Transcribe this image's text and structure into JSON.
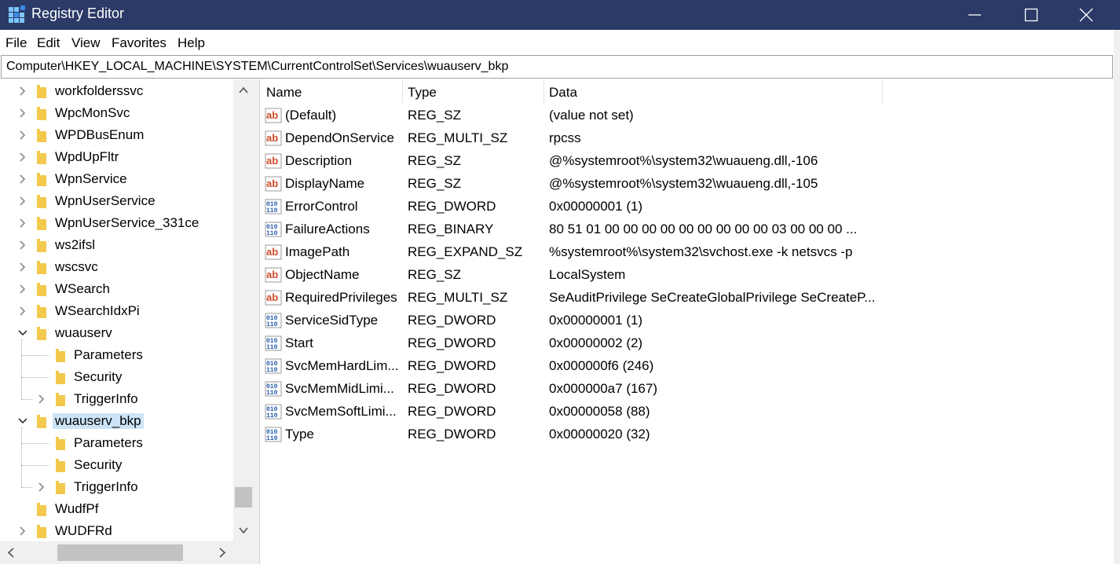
{
  "window": {
    "title": "Registry Editor",
    "title_bar_color": "#2b3a67"
  },
  "menu": [
    "File",
    "Edit",
    "View",
    "Favorites",
    "Help"
  ],
  "address": "Computer\\HKEY_LOCAL_MACHINE\\SYSTEM\\CurrentControlSet\\Services\\wuauserv_bkp",
  "tree": [
    {
      "label": "workfolderssvc",
      "level": 0,
      "expander": "collapsed"
    },
    {
      "label": "WpcMonSvc",
      "level": 0,
      "expander": "collapsed"
    },
    {
      "label": "WPDBusEnum",
      "level": 0,
      "expander": "collapsed"
    },
    {
      "label": "WpdUpFltr",
      "level": 0,
      "expander": "collapsed"
    },
    {
      "label": "WpnService",
      "level": 0,
      "expander": "collapsed"
    },
    {
      "label": "WpnUserService",
      "level": 0,
      "expander": "collapsed"
    },
    {
      "label": "WpnUserService_331ce",
      "level": 0,
      "expander": "collapsed"
    },
    {
      "label": "ws2ifsl",
      "level": 0,
      "expander": "collapsed"
    },
    {
      "label": "wscsvc",
      "level": 0,
      "expander": "collapsed"
    },
    {
      "label": "WSearch",
      "level": 0,
      "expander": "collapsed"
    },
    {
      "label": "WSearchIdxPi",
      "level": 0,
      "expander": "collapsed"
    },
    {
      "label": "wuauserv",
      "level": 0,
      "expander": "expanded"
    },
    {
      "label": "Parameters",
      "level": 1,
      "expander": "none"
    },
    {
      "label": "Security",
      "level": 1,
      "expander": "none"
    },
    {
      "label": "TriggerInfo",
      "level": 1,
      "expander": "collapsed"
    },
    {
      "label": "wuauserv_bkp",
      "level": 0,
      "expander": "expanded",
      "selected": true
    },
    {
      "label": "Parameters",
      "level": 1,
      "expander": "none"
    },
    {
      "label": "Security",
      "level": 1,
      "expander": "none"
    },
    {
      "label": "TriggerInfo",
      "level": 1,
      "expander": "collapsed"
    },
    {
      "label": "WudfPf",
      "level": 0,
      "expander": "none"
    },
    {
      "label": "WUDFRd",
      "level": 0,
      "expander": "collapsed"
    }
  ],
  "columns": {
    "name": "Name",
    "type": "Type",
    "data": "Data"
  },
  "values": [
    {
      "name": "(Default)",
      "type": "REG_SZ",
      "data": "(value not set)",
      "icon": "string-value-icon"
    },
    {
      "name": "DependOnService",
      "type": "REG_MULTI_SZ",
      "data": "rpcss",
      "icon": "string-value-icon"
    },
    {
      "name": "Description",
      "type": "REG_SZ",
      "data": "@%systemroot%\\system32\\wuaueng.dll,-106",
      "icon": "string-value-icon"
    },
    {
      "name": "DisplayName",
      "type": "REG_SZ",
      "data": "@%systemroot%\\system32\\wuaueng.dll,-105",
      "icon": "string-value-icon"
    },
    {
      "name": "ErrorControl",
      "type": "REG_DWORD",
      "data": "0x00000001 (1)",
      "icon": "binary-value-icon"
    },
    {
      "name": "FailureActions",
      "type": "REG_BINARY",
      "data": "80 51 01 00 00 00 00 00 00 00 00 00 03 00 00 00 ...",
      "icon": "binary-value-icon"
    },
    {
      "name": "ImagePath",
      "type": "REG_EXPAND_SZ",
      "data": "%systemroot%\\system32\\svchost.exe -k netsvcs -p",
      "icon": "string-value-icon"
    },
    {
      "name": "ObjectName",
      "type": "REG_SZ",
      "data": "LocalSystem",
      "icon": "string-value-icon"
    },
    {
      "name": "RequiredPrivileges",
      "type": "REG_MULTI_SZ",
      "data": "SeAuditPrivilege SeCreateGlobalPrivilege SeCreateP...",
      "icon": "string-value-icon"
    },
    {
      "name": "ServiceSidType",
      "type": "REG_DWORD",
      "data": "0x00000001 (1)",
      "icon": "binary-value-icon"
    },
    {
      "name": "Start",
      "type": "REG_DWORD",
      "data": "0x00000002 (2)",
      "icon": "binary-value-icon"
    },
    {
      "name": "SvcMemHardLim...",
      "type": "REG_DWORD",
      "data": "0x000000f6 (246)",
      "icon": "binary-value-icon"
    },
    {
      "name": "SvcMemMidLimi...",
      "type": "REG_DWORD",
      "data": "0x000000a7 (167)",
      "icon": "binary-value-icon"
    },
    {
      "name": "SvcMemSoftLimi...",
      "type": "REG_DWORD",
      "data": "0x00000058 (88)",
      "icon": "binary-value-icon"
    },
    {
      "name": "Type",
      "type": "REG_DWORD",
      "data": "0x00000020 (32)",
      "icon": "binary-value-icon"
    }
  ],
  "colors": {
    "selection": "#cce4f7",
    "folder": "#f2c94c",
    "string_icon": "#d04a2a",
    "binary_icon": "#2a5db0"
  }
}
